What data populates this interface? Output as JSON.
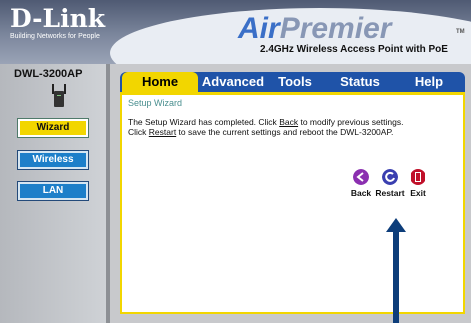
{
  "header": {
    "logo_text": "D-Link",
    "logo_tagline": "Building Networks for People",
    "brand_air": "Air",
    "brand_premier": "Premier",
    "brand_tm": "TM",
    "product_description": "2.4GHz Wireless Access Point with PoE"
  },
  "sidebar": {
    "model": "DWL-3200AP",
    "buttons": [
      {
        "label": "Wizard",
        "active": true
      },
      {
        "label": "Wireless",
        "active": false
      },
      {
        "label": "LAN",
        "active": false
      }
    ]
  },
  "tabs": {
    "home": "Home",
    "advanced": "Advanced",
    "tools": "Tools",
    "status": "Status",
    "help": "Help"
  },
  "content": {
    "section_title": "Setup Wizard",
    "line1_pre": "The Setup Wizard has completed. Click ",
    "line1_link": "Back",
    "line1_post": " to modify previous settings.",
    "line2_pre": "Click ",
    "line2_link": "Restart",
    "line2_post": " to save the current settings and reboot the DWL-3200AP."
  },
  "actions": {
    "back": "Back",
    "restart": "Restart",
    "exit": "Exit"
  },
  "colors": {
    "accent_yellow": "#f2d600",
    "tab_blue": "#1f53a8",
    "button_blue": "#1d7fc9",
    "annotation_arrow": "#0d3d7a"
  }
}
